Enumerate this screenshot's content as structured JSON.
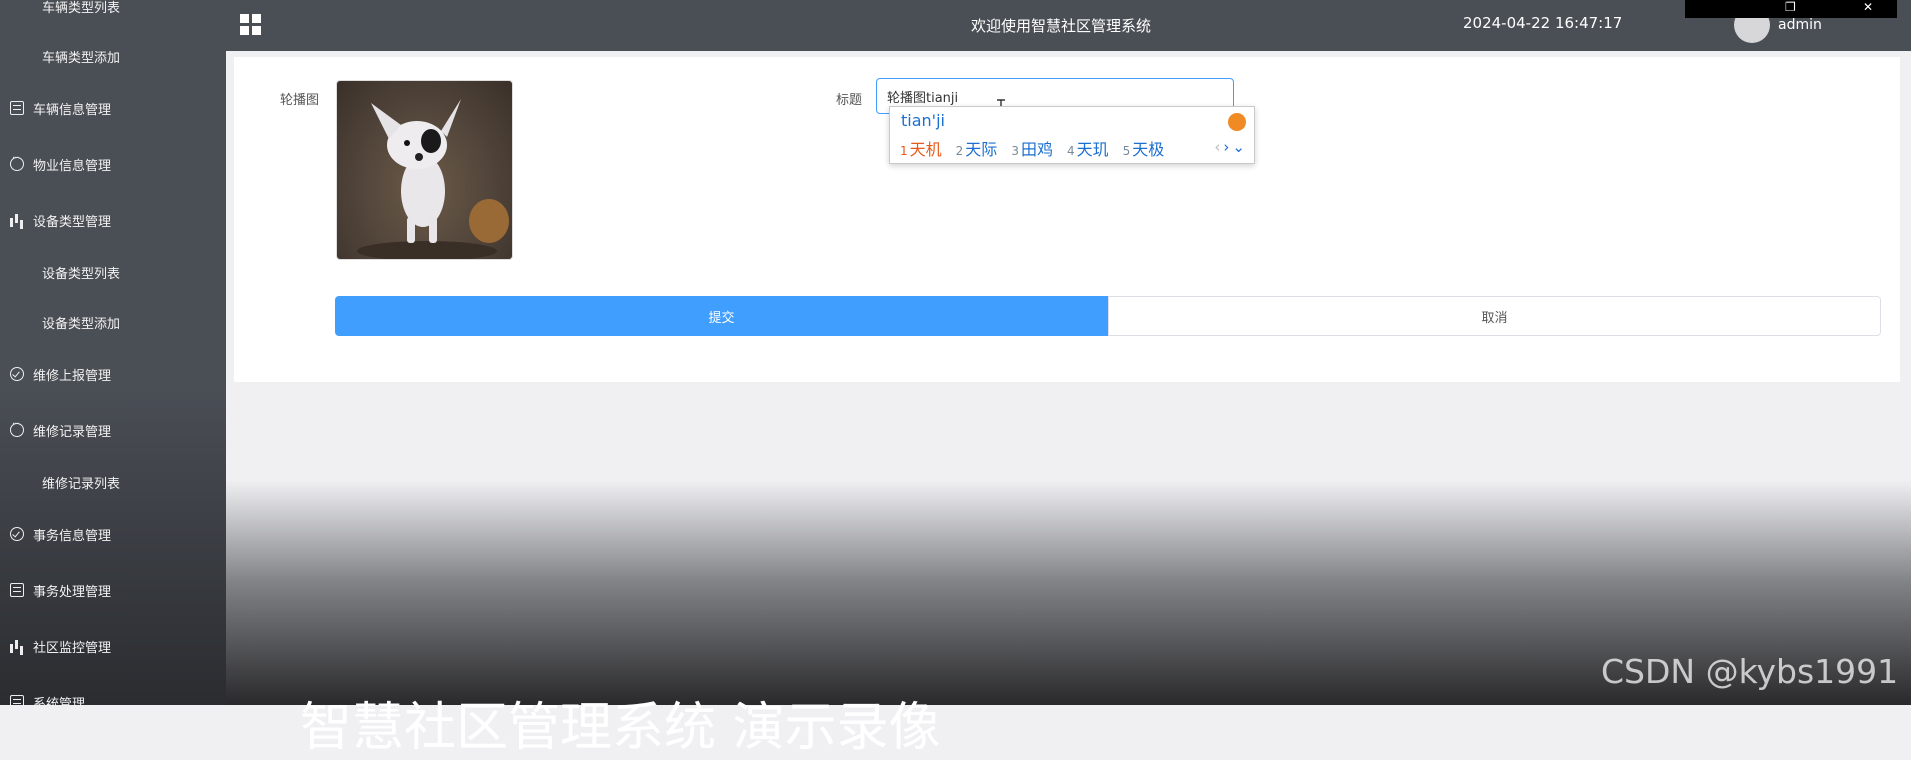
{
  "sidebar": {
    "items": [
      {
        "label": "车辆类型列表",
        "type": "sub"
      },
      {
        "label": "车辆类型添加",
        "type": "sub"
      },
      {
        "label": "车辆信息管理",
        "type": "main",
        "icon": "document-icon"
      },
      {
        "label": "物业信息管理",
        "type": "main",
        "icon": "chat-icon"
      },
      {
        "label": "设备类型管理",
        "type": "main",
        "icon": "bar-chart-icon"
      },
      {
        "label": "设备类型列表",
        "type": "sub"
      },
      {
        "label": "设备类型添加",
        "type": "sub"
      },
      {
        "label": "维修上报管理",
        "type": "main",
        "icon": "check-circle-icon"
      },
      {
        "label": "维修记录管理",
        "type": "main",
        "icon": "chat-icon"
      },
      {
        "label": "维修记录列表",
        "type": "sub"
      },
      {
        "label": "事务信息管理",
        "type": "main",
        "icon": "check-circle-icon"
      },
      {
        "label": "事务处理管理",
        "type": "main",
        "icon": "document-icon"
      },
      {
        "label": "社区监控管理",
        "type": "main",
        "icon": "bar-chart-icon"
      },
      {
        "label": "系统管理",
        "type": "main",
        "icon": "document-icon"
      }
    ]
  },
  "header": {
    "title": "欢迎使用智慧社区管理系统",
    "datetime": "2024-04-22 16:47:17",
    "username": "admin"
  },
  "form": {
    "carousel_label": "轮播图",
    "title_label": "标题",
    "title_value": "轮播图tianji",
    "submit_label": "提交",
    "cancel_label": "取消"
  },
  "ime": {
    "pinyin": "tian'ji",
    "candidates": [
      {
        "num": "1",
        "word": "天机"
      },
      {
        "num": "2",
        "word": "天际"
      },
      {
        "num": "3",
        "word": "田鸡"
      },
      {
        "num": "4",
        "word": "天玑"
      },
      {
        "num": "5",
        "word": "天极"
      }
    ],
    "nav_prev": "‹",
    "nav_next": "›",
    "nav_more": "⌄"
  },
  "overlay": {
    "watermark": "CSDN @kybs1991",
    "subtitle": "智慧社区管理系统 演示录像"
  },
  "colors": {
    "sidebar_bg": "#4a4e55",
    "header_bg": "#4a4e55",
    "primary": "#409eff",
    "candidate_highlight": "#e55a1c"
  }
}
